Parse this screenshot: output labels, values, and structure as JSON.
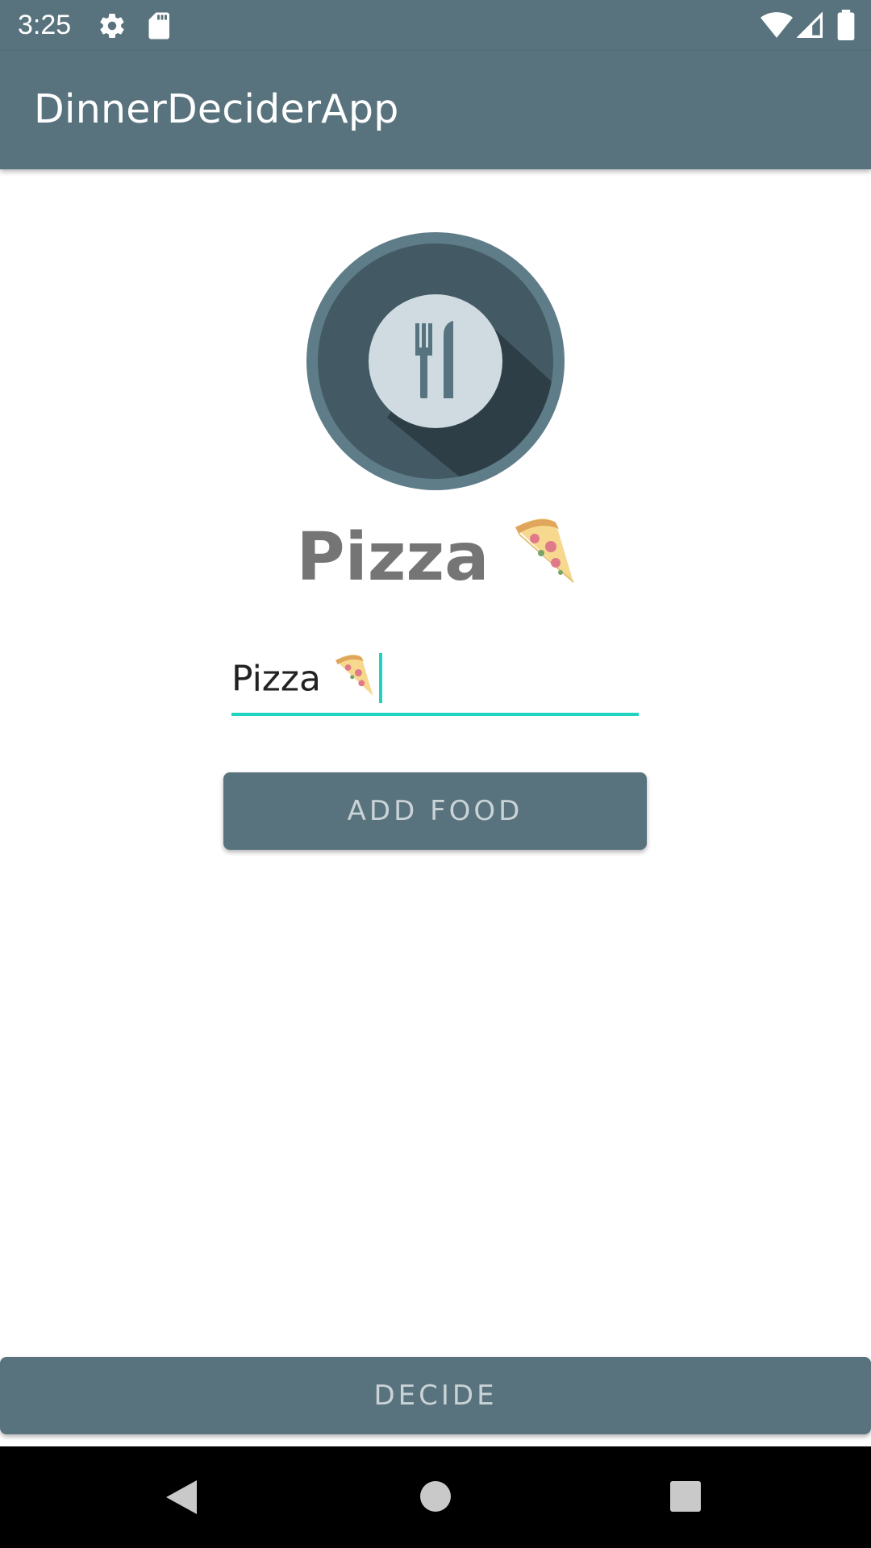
{
  "status_bar": {
    "time": "3:25",
    "icons": [
      "gear-icon",
      "sd-card-icon",
      "wifi-icon",
      "cell-signal-icon",
      "battery-icon"
    ]
  },
  "app_bar": {
    "title": "DinnerDeciderApp"
  },
  "main": {
    "logo_icon": "plate-fork-knife-icon",
    "selected_food": "Pizza",
    "selected_food_emoji_icon": "pizza-slice-icon",
    "food_input": {
      "value": "Pizza",
      "emoji_icon": "pizza-slice-icon"
    },
    "add_food_label": "ADD FOOD",
    "decide_label": "DECIDE"
  },
  "nav_bar": {
    "back_icon": "back-triangle-icon",
    "home_icon": "home-circle-icon",
    "recents_icon": "recents-square-icon"
  },
  "colors": {
    "primary": "#58737d",
    "accent": "#1fd3c1",
    "button_text": "#c9d3d7",
    "food_text": "#757575"
  }
}
